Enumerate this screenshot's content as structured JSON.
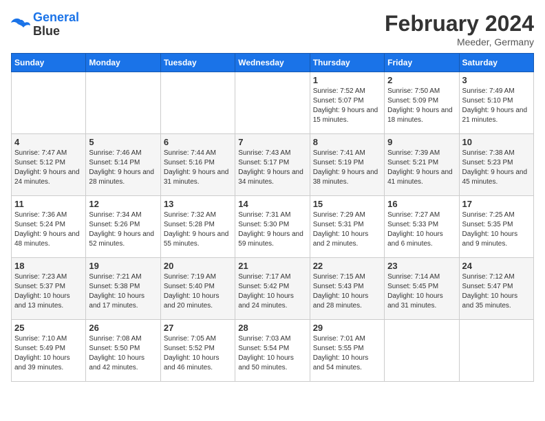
{
  "header": {
    "logo_line1": "General",
    "logo_line2": "Blue",
    "month": "February 2024",
    "location": "Meeder, Germany"
  },
  "days_of_week": [
    "Sunday",
    "Monday",
    "Tuesday",
    "Wednesday",
    "Thursday",
    "Friday",
    "Saturday"
  ],
  "weeks": [
    [
      {
        "day": "",
        "empty": true
      },
      {
        "day": "",
        "empty": true
      },
      {
        "day": "",
        "empty": true
      },
      {
        "day": "",
        "empty": true
      },
      {
        "day": "1",
        "sunrise": "7:52 AM",
        "sunset": "5:07 PM",
        "daylight": "9 hours and 15 minutes."
      },
      {
        "day": "2",
        "sunrise": "7:50 AM",
        "sunset": "5:09 PM",
        "daylight": "9 hours and 18 minutes."
      },
      {
        "day": "3",
        "sunrise": "7:49 AM",
        "sunset": "5:10 PM",
        "daylight": "9 hours and 21 minutes."
      }
    ],
    [
      {
        "day": "4",
        "sunrise": "7:47 AM",
        "sunset": "5:12 PM",
        "daylight": "9 hours and 24 minutes."
      },
      {
        "day": "5",
        "sunrise": "7:46 AM",
        "sunset": "5:14 PM",
        "daylight": "9 hours and 28 minutes."
      },
      {
        "day": "6",
        "sunrise": "7:44 AM",
        "sunset": "5:16 PM",
        "daylight": "9 hours and 31 minutes."
      },
      {
        "day": "7",
        "sunrise": "7:43 AM",
        "sunset": "5:17 PM",
        "daylight": "9 hours and 34 minutes."
      },
      {
        "day": "8",
        "sunrise": "7:41 AM",
        "sunset": "5:19 PM",
        "daylight": "9 hours and 38 minutes."
      },
      {
        "day": "9",
        "sunrise": "7:39 AM",
        "sunset": "5:21 PM",
        "daylight": "9 hours and 41 minutes."
      },
      {
        "day": "10",
        "sunrise": "7:38 AM",
        "sunset": "5:23 PM",
        "daylight": "9 hours and 45 minutes."
      }
    ],
    [
      {
        "day": "11",
        "sunrise": "7:36 AM",
        "sunset": "5:24 PM",
        "daylight": "9 hours and 48 minutes."
      },
      {
        "day": "12",
        "sunrise": "7:34 AM",
        "sunset": "5:26 PM",
        "daylight": "9 hours and 52 minutes."
      },
      {
        "day": "13",
        "sunrise": "7:32 AM",
        "sunset": "5:28 PM",
        "daylight": "9 hours and 55 minutes."
      },
      {
        "day": "14",
        "sunrise": "7:31 AM",
        "sunset": "5:30 PM",
        "daylight": "9 hours and 59 minutes."
      },
      {
        "day": "15",
        "sunrise": "7:29 AM",
        "sunset": "5:31 PM",
        "daylight": "10 hours and 2 minutes."
      },
      {
        "day": "16",
        "sunrise": "7:27 AM",
        "sunset": "5:33 PM",
        "daylight": "10 hours and 6 minutes."
      },
      {
        "day": "17",
        "sunrise": "7:25 AM",
        "sunset": "5:35 PM",
        "daylight": "10 hours and 9 minutes."
      }
    ],
    [
      {
        "day": "18",
        "sunrise": "7:23 AM",
        "sunset": "5:37 PM",
        "daylight": "10 hours and 13 minutes."
      },
      {
        "day": "19",
        "sunrise": "7:21 AM",
        "sunset": "5:38 PM",
        "daylight": "10 hours and 17 minutes."
      },
      {
        "day": "20",
        "sunrise": "7:19 AM",
        "sunset": "5:40 PM",
        "daylight": "10 hours and 20 minutes."
      },
      {
        "day": "21",
        "sunrise": "7:17 AM",
        "sunset": "5:42 PM",
        "daylight": "10 hours and 24 minutes."
      },
      {
        "day": "22",
        "sunrise": "7:15 AM",
        "sunset": "5:43 PM",
        "daylight": "10 hours and 28 minutes."
      },
      {
        "day": "23",
        "sunrise": "7:14 AM",
        "sunset": "5:45 PM",
        "daylight": "10 hours and 31 minutes."
      },
      {
        "day": "24",
        "sunrise": "7:12 AM",
        "sunset": "5:47 PM",
        "daylight": "10 hours and 35 minutes."
      }
    ],
    [
      {
        "day": "25",
        "sunrise": "7:10 AM",
        "sunset": "5:49 PM",
        "daylight": "10 hours and 39 minutes."
      },
      {
        "day": "26",
        "sunrise": "7:08 AM",
        "sunset": "5:50 PM",
        "daylight": "10 hours and 42 minutes."
      },
      {
        "day": "27",
        "sunrise": "7:05 AM",
        "sunset": "5:52 PM",
        "daylight": "10 hours and 46 minutes."
      },
      {
        "day": "28",
        "sunrise": "7:03 AM",
        "sunset": "5:54 PM",
        "daylight": "10 hours and 50 minutes."
      },
      {
        "day": "29",
        "sunrise": "7:01 AM",
        "sunset": "5:55 PM",
        "daylight": "10 hours and 54 minutes."
      },
      {
        "day": "",
        "empty": true
      },
      {
        "day": "",
        "empty": true
      }
    ]
  ]
}
